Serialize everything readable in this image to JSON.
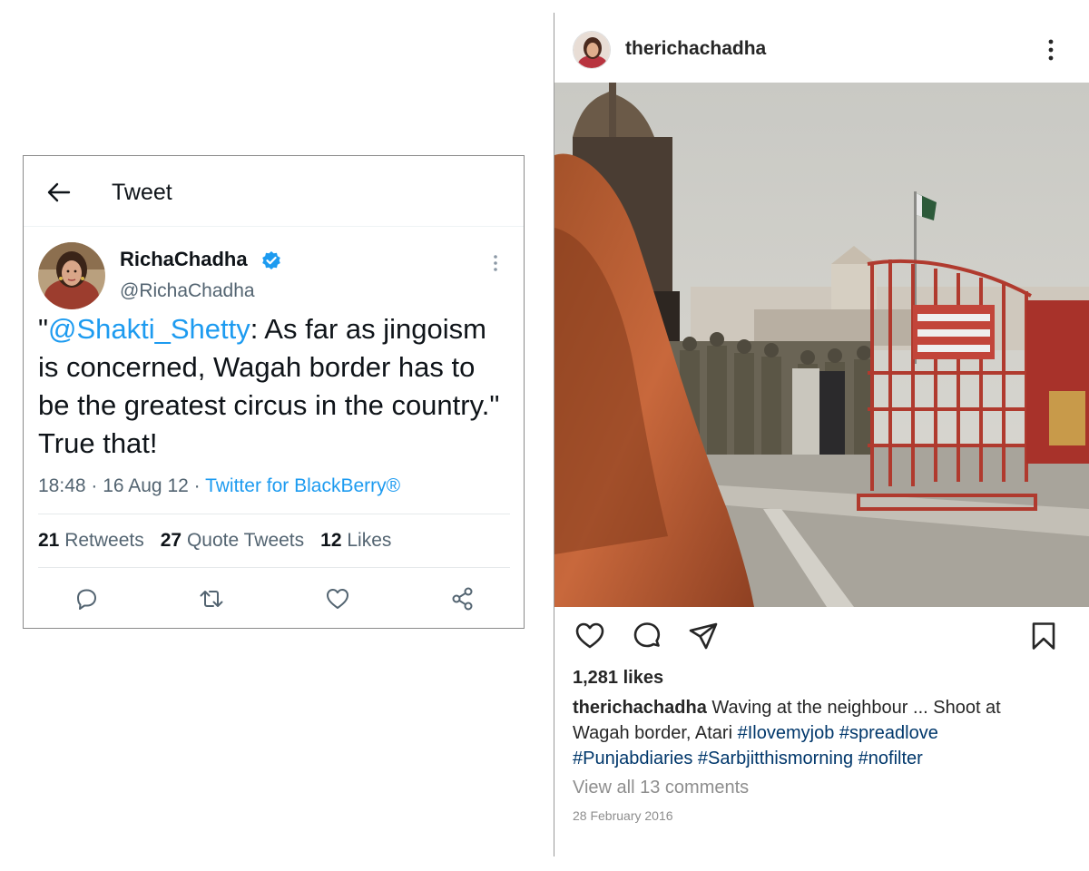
{
  "tweet": {
    "header_title": "Tweet",
    "author_name": "RichaChadha",
    "author_handle": "@RichaChadha",
    "text_open_quote": "\"",
    "mention": "@Shakti_Shetty",
    "text_rest": ": As far as jingoism is concerned, Wagah border has to be the greatest circus in the country.\" True that!",
    "time_date": "18:48 · 16 Aug 12 · ",
    "source": "Twitter for BlackBerry®",
    "stats": {
      "retweets_count": "21",
      "retweets_label": "Retweets",
      "quotes_count": "27",
      "quotes_label": "Quote Tweets",
      "likes_count": "12",
      "likes_label": "Likes"
    },
    "accent_color": "#1d9bf0",
    "icons": [
      "back-arrow-icon",
      "verified-badge-icon",
      "more-vertical-icon",
      "reply-icon",
      "retweet-icon",
      "like-icon",
      "share-icon"
    ]
  },
  "instagram": {
    "username": "therichachadha",
    "likes": "1,281 likes",
    "caption_user": "therichachadha",
    "caption_text": " Waving at the neighbour ... Shoot at Wagah border, Atari ",
    "hashtags": [
      "#Ilovemyjob",
      "#spreadlove",
      "#Punjabdiaries",
      "#Sarbjitthismorning",
      "#nofilter"
    ],
    "view_comments": "View all 13 comments",
    "date": "28 February 2016",
    "icons": [
      "more-vertical-icon",
      "heart-icon",
      "comment-icon",
      "send-icon",
      "bookmark-icon"
    ]
  }
}
